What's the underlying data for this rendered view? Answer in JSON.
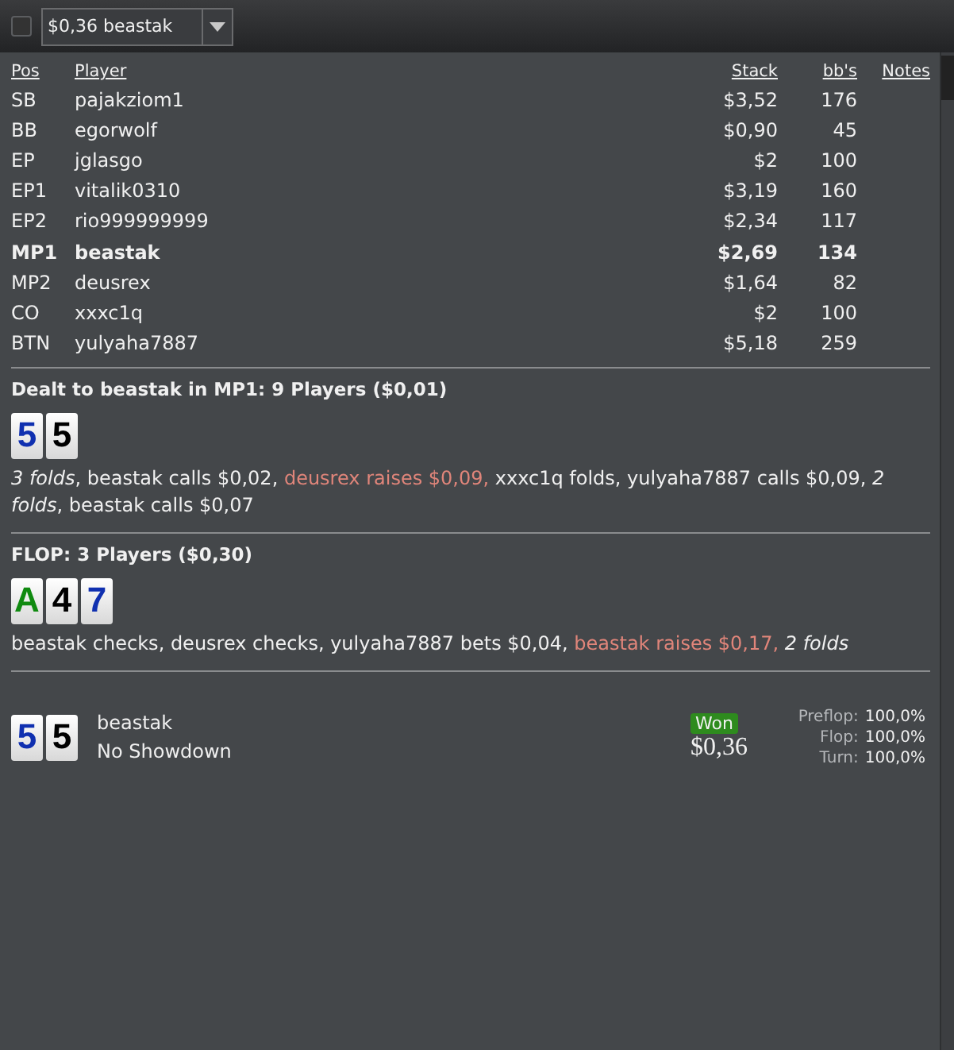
{
  "toolbar": {
    "checkbox": {
      "checked": false
    },
    "hand_select": {
      "value": "$0,36 beastak"
    }
  },
  "players": {
    "columns": [
      "Pos",
      "Player",
      "Stack",
      "bb's",
      "Notes"
    ],
    "rows": [
      {
        "pos": "SB",
        "player": "pajakziom1",
        "stack": "$3,52",
        "bbs": "176",
        "hero": false
      },
      {
        "pos": "BB",
        "player": "egorwolf",
        "stack": "$0,90",
        "bbs": "45",
        "hero": false
      },
      {
        "pos": "EP",
        "player": "jglasgo",
        "stack": "$2",
        "bbs": "100",
        "hero": false
      },
      {
        "pos": "EP1",
        "player": "vitalik0310",
        "stack": "$3,19",
        "bbs": "160",
        "hero": false
      },
      {
        "pos": "EP2",
        "player": "rio999999999",
        "stack": "$2,34",
        "bbs": "117",
        "hero": false
      },
      {
        "pos": "MP1",
        "player": "beastak",
        "stack": "$2,69",
        "bbs": "134",
        "hero": true
      },
      {
        "pos": "MP2",
        "player": "deusrex",
        "stack": "$1,64",
        "bbs": "82",
        "hero": false
      },
      {
        "pos": "CO",
        "player": "xxxc1q",
        "stack": "$2",
        "bbs": "100",
        "hero": false
      },
      {
        "pos": "BTN",
        "player": "yulyaha7887",
        "stack": "$5,18",
        "bbs": "259",
        "hero": false
      }
    ]
  },
  "streets": [
    {
      "title": "Dealt to beastak in MP1: 9 Players ($0,01)",
      "cards": [
        {
          "rank": "5",
          "color": "#1030b0"
        },
        {
          "rank": "5",
          "color": "#000000"
        }
      ],
      "actions": [
        {
          "text": "3 folds",
          "kind": "fold"
        },
        {
          "text": ", beastak calls $0,02, ",
          "kind": "plain"
        },
        {
          "text": "deusrex raises $0,09, ",
          "kind": "raise"
        },
        {
          "text": "xxxc1q folds, yulyaha7887 calls $0,09, ",
          "kind": "plain"
        },
        {
          "text": "2 folds",
          "kind": "fold"
        },
        {
          "text": ", beastak calls $0,07",
          "kind": "plain"
        }
      ]
    },
    {
      "title": "FLOP: 3 Players ($0,30)",
      "cards": [
        {
          "rank": "A",
          "color": "#108a10"
        },
        {
          "rank": "4",
          "color": "#000000"
        },
        {
          "rank": "7",
          "color": "#1030b0"
        }
      ],
      "actions": [
        {
          "text": "beastak checks, deusrex checks, yulyaha7887 bets $0,04, ",
          "kind": "plain"
        },
        {
          "text": "beastak raises $0,17, ",
          "kind": "raise"
        },
        {
          "text": "2 folds",
          "kind": "fold"
        }
      ]
    }
  ],
  "result": {
    "cards": [
      {
        "rank": "5",
        "color": "#1030b0"
      },
      {
        "rank": "5",
        "color": "#000000"
      }
    ],
    "player": "beastak",
    "showdown": "No Showdown",
    "badge": "Won",
    "amount": "$0,36",
    "equity": [
      {
        "label": "Preflop:",
        "value": "100,0%"
      },
      {
        "label": "Flop:",
        "value": "100,0%"
      },
      {
        "label": "Turn:",
        "value": "100,0%"
      }
    ]
  }
}
